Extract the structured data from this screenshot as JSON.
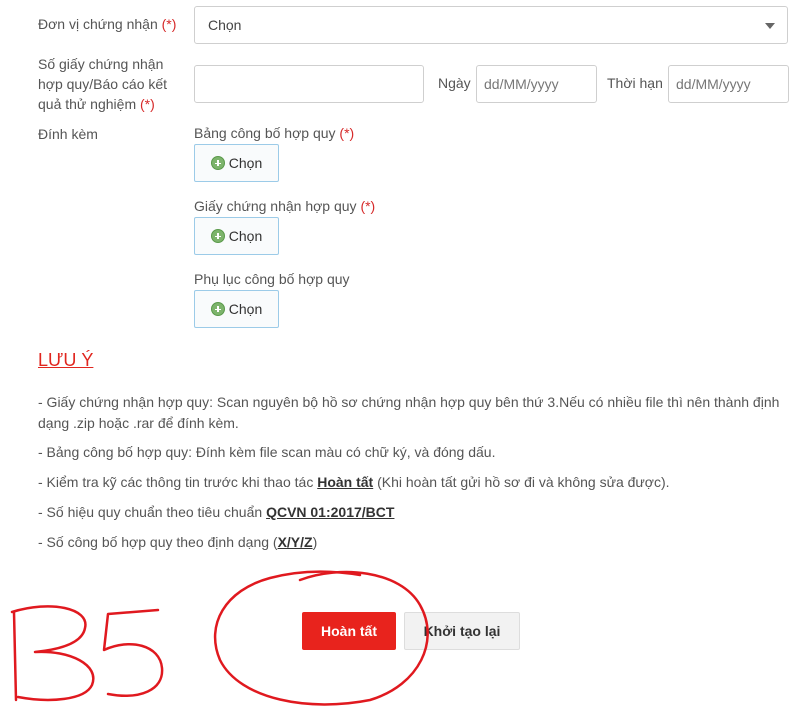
{
  "form": {
    "unit_label": "Đơn vị chứng nhận",
    "required_mark": "(*)",
    "unit_value": "Chọn",
    "cert_label_line1": "Số giấy chứng nhận",
    "cert_label_line2": "hợp quy/Báo cáo kết",
    "cert_label_line3": "quả thử nghiệm",
    "cert_value": "",
    "date_label": "Ngày",
    "date_placeholder": "dd/MM/yyyy",
    "expiry_label": "Thời hạn",
    "expiry_placeholder": "dd/MM/yyyy",
    "attach_label": "Đính kèm",
    "attachments": [
      {
        "label": "Bảng công bố hợp quy",
        "required": true,
        "button": "Chọn"
      },
      {
        "label": "Giấy chứng nhận hợp quy",
        "required": true,
        "button": "Chọn"
      },
      {
        "label": "Phụ lục công bố hợp quy",
        "required": false,
        "button": "Chọn"
      }
    ]
  },
  "notes": {
    "title": "LƯU Ý",
    "items": [
      {
        "text": "- Giấy chứng nhận hợp quy: Scan nguyên bộ hồ sơ chứng nhận hợp quy bên thứ 3.Nếu có nhiều file thì nên thành định dạng .zip hoặc .rar để đính kèm."
      },
      {
        "text": "- Bảng công bố hợp quy: Đính kèm file scan màu có chữ ký, và đóng dấu."
      },
      {
        "pre": "- Kiểm tra kỹ các thông tin trước khi thao tác ",
        "bold": "Hoàn tất",
        "post": " (Khi hoàn tất gửi hồ sơ đi và không sửa được)."
      },
      {
        "pre": "- Số hiệu quy chuẩn theo tiêu chuẩn ",
        "bold": "QCVN 01:2017/BCT",
        "post": ""
      },
      {
        "pre": "- Số công bố hợp quy theo định dạng (",
        "bold": "X/Y/Z",
        "post": ")"
      }
    ]
  },
  "actions": {
    "done": "Hoàn tất",
    "reset": "Khởi tạo lại"
  },
  "annotation": {
    "handwritten_text": "B5"
  },
  "colors": {
    "required": "#d62a2a",
    "primary_button": "#e8231d",
    "annotation_ink": "#e0191f"
  }
}
